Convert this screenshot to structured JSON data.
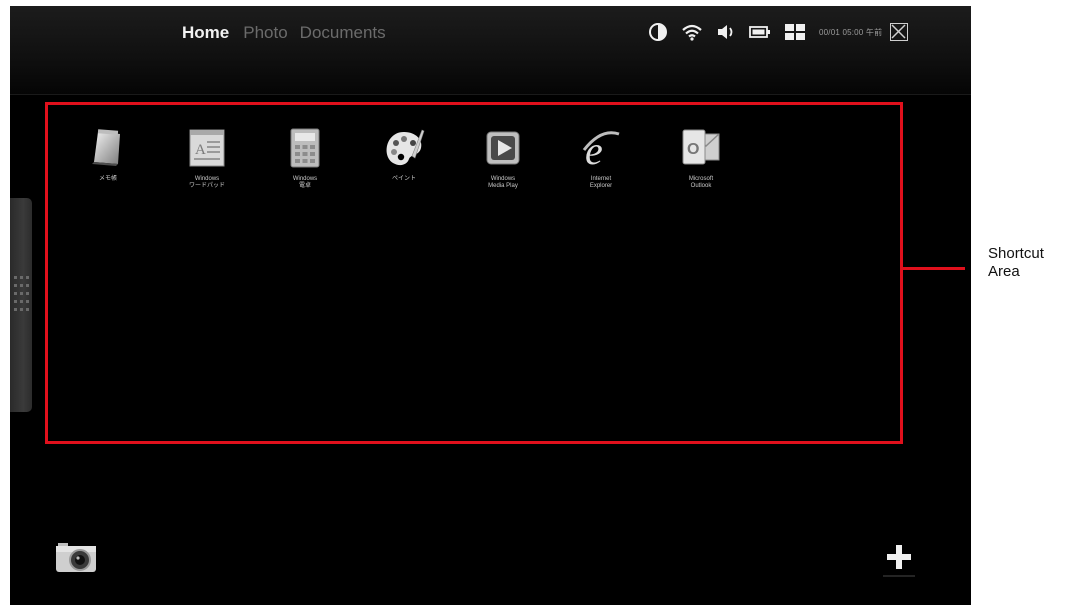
{
  "tabs": [
    {
      "label": "Home",
      "active": true
    },
    {
      "label": "Photo",
      "active": false
    },
    {
      "label": "Documents",
      "active": false
    }
  ],
  "status_tray": {
    "icons": [
      "contrast-icon",
      "wifi-icon",
      "volume-icon",
      "battery-icon",
      "grid-icon"
    ],
    "clock": "00/01 05:00 午前"
  },
  "shortcuts": [
    {
      "label": "メモ帳",
      "icon": "notepad-icon"
    },
    {
      "label": "Windows\nワードパッド",
      "icon": "wordpad-icon"
    },
    {
      "label": "Windows\n電卓",
      "icon": "calculator-icon"
    },
    {
      "label": "ペイント",
      "icon": "paint-icon"
    },
    {
      "label": "Windows\nMedia Play",
      "icon": "media-player-icon"
    },
    {
      "label": "Internet\nExplorer",
      "icon": "internet-explorer-icon"
    },
    {
      "label": "Microsoft\nOutlook",
      "icon": "outlook-icon"
    }
  ],
  "callout": {
    "label_line1": "Shortcut",
    "label_line2": "Area"
  },
  "colors": {
    "highlight": "#e0101c",
    "screen_bg": "#000000",
    "active_tab": "#f2f2f2",
    "inactive_tab": "#6b6b6b"
  }
}
